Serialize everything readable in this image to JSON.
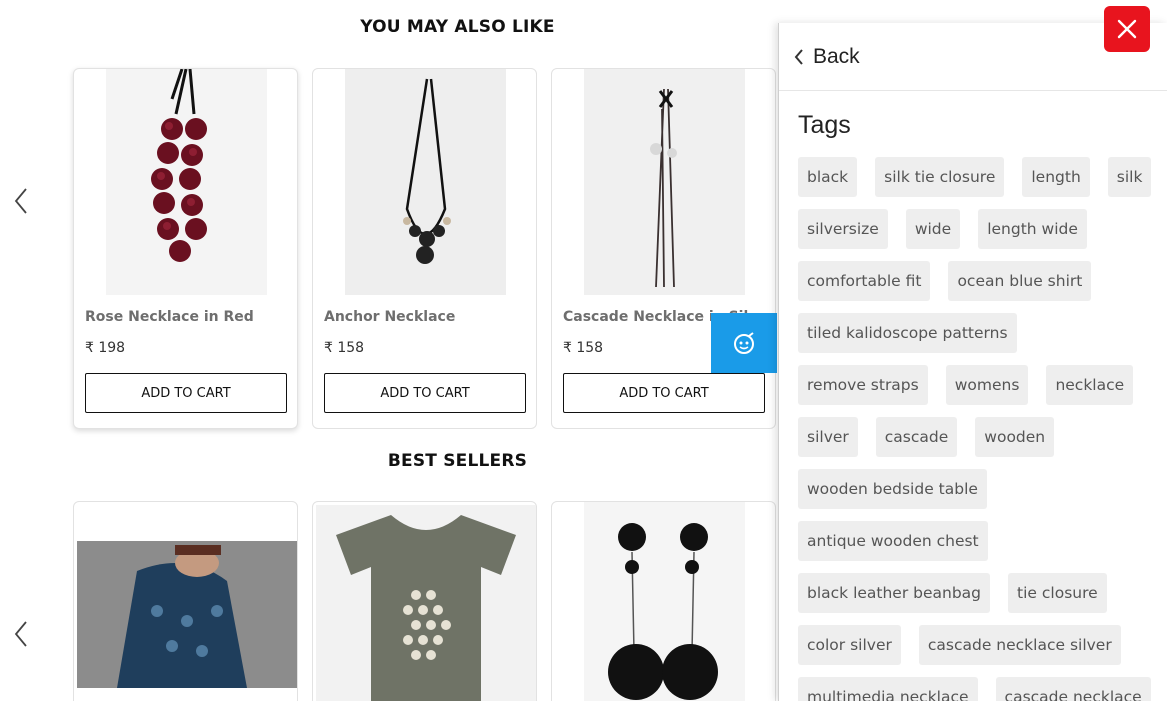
{
  "colors": {
    "accent_blue": "#1a9be8",
    "close_red": "#e8141e",
    "tag_bg": "#eeeeee"
  },
  "you_may_also_like": {
    "title": "YOU MAY ALSO LIKE",
    "products": [
      {
        "name": "Rose Necklace in Red",
        "price": "₹ 198",
        "button": "ADD TO CART"
      },
      {
        "name": "Anchor Necklace",
        "price": "₹ 158",
        "button": "ADD TO CART"
      },
      {
        "name": "Cascade Necklace in Sil",
        "price": "₹ 158",
        "button": "ADD TO CART"
      }
    ]
  },
  "best_sellers": {
    "title": "BEST SELLERS"
  },
  "panel": {
    "back_label": "Back",
    "tags_title": "Tags",
    "tags": [
      "black",
      "silk tie closure",
      "length",
      "silk",
      "silversize",
      "wide",
      "length wide",
      "comfortable fit",
      "ocean blue shirt",
      "tiled kalidoscope patterns",
      "remove straps",
      "womens",
      "necklace",
      "silver",
      "cascade",
      "wooden",
      "wooden bedside table",
      "antique wooden chest",
      "black leather beanbag",
      "tie closure",
      "color silver",
      "cascade necklace silver",
      "multimedia necklace",
      "cascade necklace"
    ]
  },
  "icons": [
    "chevron-left-icon",
    "close-icon",
    "chat-bot-icon",
    "back-chevron-icon"
  ]
}
